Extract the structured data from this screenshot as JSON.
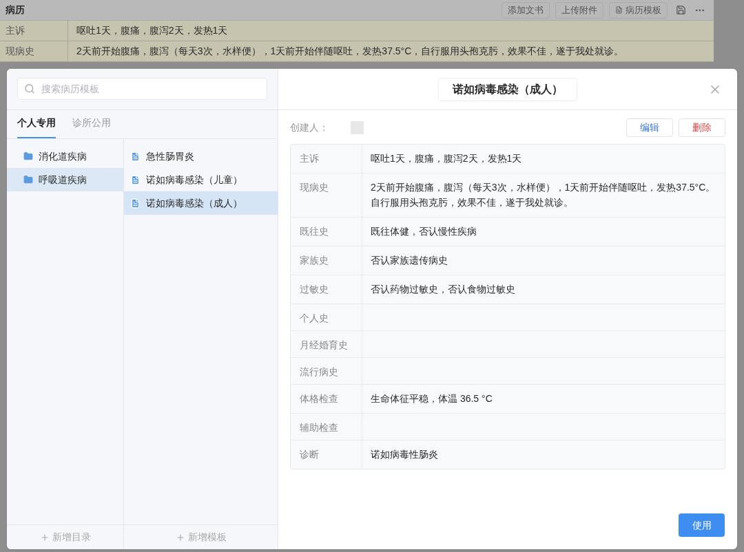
{
  "background": {
    "title": "病历",
    "toolbar": [
      "添加文书",
      "上传附件"
    ],
    "template_button": "病历模板",
    "rows": [
      {
        "label": "主诉",
        "value": "呕吐1天，腹痛，腹泻2天，发热1天"
      },
      {
        "label": "现病史",
        "value": "2天前开始腹痛，腹泻（每天3次，水样便），1天前开始伴随呕吐，发热37.5°C，自行服用头孢克肟，效果不佳，遂于我处就诊。"
      }
    ]
  },
  "modal": {
    "search": {
      "placeholder": "搜索病历模板"
    },
    "tabs": [
      {
        "label": "个人专用",
        "selected": true
      },
      {
        "label": "诊所公用",
        "selected": false
      }
    ],
    "folders": [
      {
        "label": "消化道疾病",
        "selected": false
      },
      {
        "label": "呼吸道疾病",
        "selected": true
      }
    ],
    "templates": [
      {
        "label": "急性肠胃炎",
        "selected": false
      },
      {
        "label": "诺如病毒感染（儿童）",
        "selected": false
      },
      {
        "label": "诺如病毒感染（成人）",
        "selected": true
      }
    ],
    "add_folder": "新增目录",
    "add_template": "新增模板",
    "detail": {
      "title": "诺如病毒感染（成人）",
      "creator_label": "创建人：",
      "edit": "编辑",
      "delete": "删除",
      "fields": [
        {
          "label": "主诉",
          "value": "呕吐1天，腹痛，腹泻2天，发热1天"
        },
        {
          "label": "现病史",
          "value": "2天前开始腹痛，腹泻（每天3次，水样便），1天前开始伴随呕吐，发热37.5°C。自行服用头孢克肟，效果不佳，遂于我处就诊。"
        },
        {
          "label": "既往史",
          "value": "既往体健，否认慢性疾病"
        },
        {
          "label": "家族史",
          "value": "否认家族遗传病史"
        },
        {
          "label": "过敏史",
          "value": "否认药物过敏史，否认食物过敏史"
        },
        {
          "label": "个人史"
        },
        {
          "label": "月经婚育史"
        },
        {
          "label": "流行病史"
        },
        {
          "label": "体格检查",
          "value": "生命体征平稳，体温 36.5 °C"
        },
        {
          "label": "辅助检查"
        },
        {
          "label": "诊断",
          "value": "诺如病毒性肠炎"
        }
      ],
      "use": "使用"
    }
  }
}
